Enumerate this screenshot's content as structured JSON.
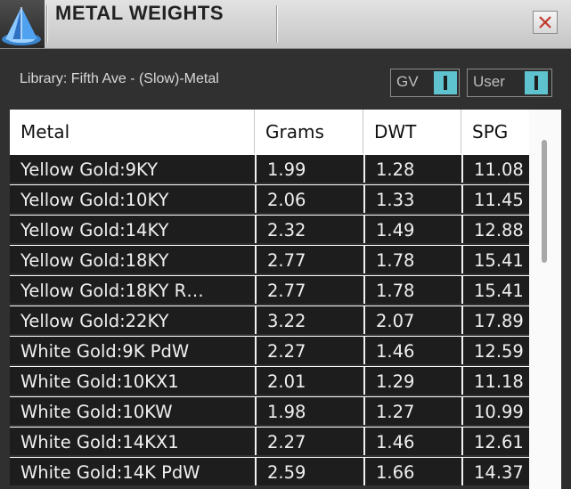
{
  "window": {
    "title": "METAL WEIGHTS",
    "close_icon": "close-x-icon",
    "app_icon": "pyramid-scale-icon"
  },
  "library_label": "Library: Fifth Ave - (Slow)-Metal",
  "toggles": [
    {
      "label": "GV",
      "on": true
    },
    {
      "label": "User",
      "on": true
    }
  ],
  "table": {
    "columns": [
      "Metal",
      "Grams",
      "DWT",
      "SPG"
    ],
    "rows": [
      {
        "metal": "Yellow Gold:9KY",
        "grams": "1.99",
        "dwt": "1.28",
        "spg": "11.08"
      },
      {
        "metal": "Yellow Gold:10KY",
        "grams": "2.06",
        "dwt": "1.33",
        "spg": "11.45"
      },
      {
        "metal": "Yellow Gold:14KY",
        "grams": "2.32",
        "dwt": "1.49",
        "spg": "12.88"
      },
      {
        "metal": "Yellow Gold:18KY",
        "grams": "2.77",
        "dwt": "1.78",
        "spg": "15.41"
      },
      {
        "metal": "Yellow Gold:18KY R…",
        "grams": "2.77",
        "dwt": "1.78",
        "spg": "15.41"
      },
      {
        "metal": "Yellow Gold:22KY",
        "grams": "3.22",
        "dwt": "2.07",
        "spg": "17.89"
      },
      {
        "metal": "White Gold:9K PdW",
        "grams": "2.27",
        "dwt": "1.46",
        "spg": "12.59"
      },
      {
        "metal": "White Gold:10KX1",
        "grams": "2.01",
        "dwt": "1.29",
        "spg": "11.18"
      },
      {
        "metal": "White Gold:10KW",
        "grams": "1.98",
        "dwt": "1.27",
        "spg": "10.99"
      },
      {
        "metal": "White Gold:14KX1",
        "grams": "2.27",
        "dwt": "1.46",
        "spg": "12.61"
      },
      {
        "metal": "White Gold:14K PdW",
        "grams": "2.59",
        "dwt": "1.66",
        "spg": "14.37"
      }
    ]
  },
  "colors": {
    "toggle_accent": "#5fc2cf",
    "close_icon": "#c0392b",
    "row_bg": "#1d1d1d",
    "header_bg": "#ffffff"
  }
}
